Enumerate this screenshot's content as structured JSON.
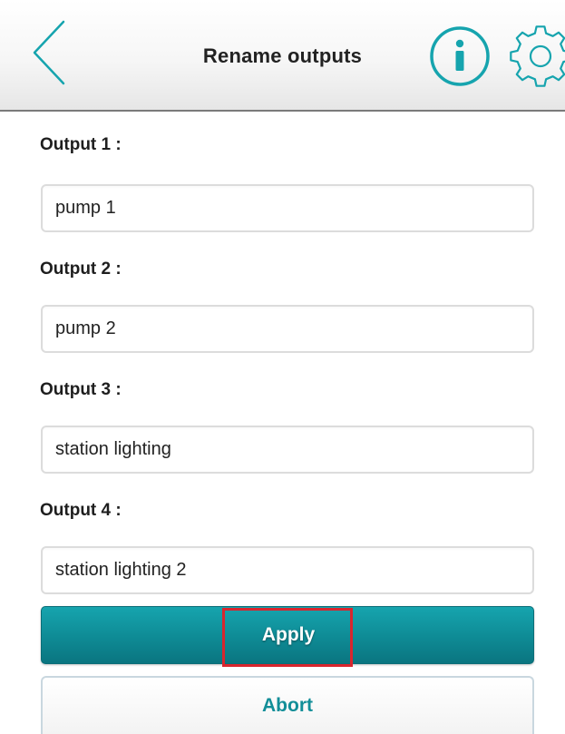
{
  "header": {
    "title": "Rename outputs",
    "back_icon": "chevron-left-icon",
    "info_icon": "info-icon",
    "settings_icon": "gear-icon"
  },
  "outputs": [
    {
      "label": "Output 1 :",
      "value": "pump 1"
    },
    {
      "label": "Output 2 :",
      "value": "pump 2"
    },
    {
      "label": "Output 3 :",
      "value": "station lighting"
    },
    {
      "label": "Output 4 :",
      "value": "station lighting 2"
    }
  ],
  "actions": {
    "apply_label": "Apply",
    "abort_label": "Abort"
  },
  "colors": {
    "accent": "#0f8d97",
    "highlight": "#d8262e",
    "icon": "#16a4ae"
  }
}
